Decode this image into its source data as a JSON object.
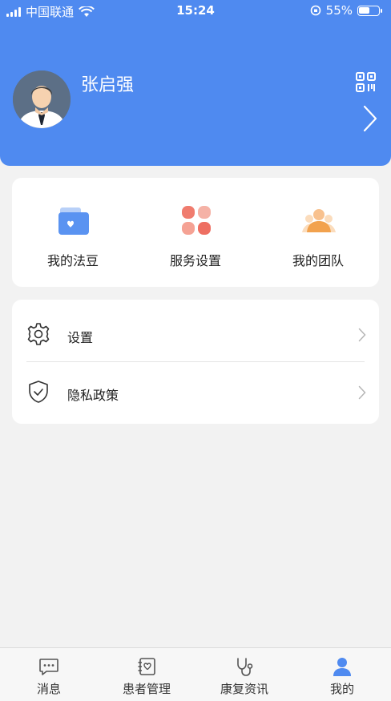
{
  "status_bar": {
    "carrier": "中国联通",
    "time": "15:24",
    "battery": "55%"
  },
  "profile": {
    "name": "张启强"
  },
  "quick_actions": [
    {
      "label": "我的法豆",
      "icon": "folder-heart-icon"
    },
    {
      "label": "服务设置",
      "icon": "four-petal-icon"
    },
    {
      "label": "我的团队",
      "icon": "team-icon"
    }
  ],
  "menu": [
    {
      "label": "设置",
      "icon": "gear-icon"
    },
    {
      "label": "隐私政策",
      "icon": "shield-check-icon"
    }
  ],
  "tabbar": {
    "active_index": 3,
    "active_color": "#4f8af0",
    "items": [
      {
        "label": "消息",
        "icon": "message-icon"
      },
      {
        "label": "患者管理",
        "icon": "patient-book-icon"
      },
      {
        "label": "康复资讯",
        "icon": "stethoscope-icon"
      },
      {
        "label": "我的",
        "icon": "person-icon"
      }
    ]
  },
  "colors": {
    "header": "#4f8af0",
    "background": "#f2f2f2"
  }
}
